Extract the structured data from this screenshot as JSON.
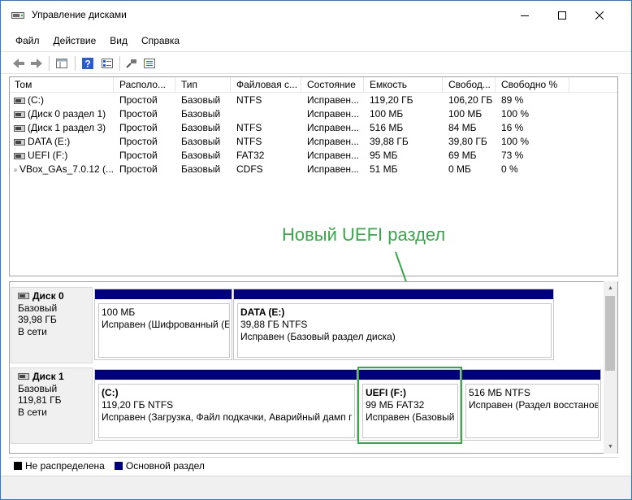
{
  "window": {
    "title": "Управление дисками"
  },
  "menu": [
    "Файл",
    "Действие",
    "Вид",
    "Справка"
  ],
  "columns": [
    "Том",
    "Располо...",
    "Тип",
    "Файловая с...",
    "Состояние",
    "Емкость",
    "Свобод...",
    "Свободно %"
  ],
  "volumes": [
    {
      "name": "(C:)",
      "layout": "Простой",
      "type": "Базовый",
      "fs": "NTFS",
      "status": "Исправен...",
      "capacity": "119,20 ГБ",
      "free": "106,20 ГБ",
      "free_pct": "89 %",
      "icon": "disk-volume-icon"
    },
    {
      "name": "(Диск 0 раздел 1)",
      "layout": "Простой",
      "type": "Базовый",
      "fs": "",
      "status": "Исправен...",
      "capacity": "100 МБ",
      "free": "100 МБ",
      "free_pct": "100 %",
      "icon": "disk-volume-icon"
    },
    {
      "name": "(Диск 1 раздел 3)",
      "layout": "Простой",
      "type": "Базовый",
      "fs": "NTFS",
      "status": "Исправен...",
      "capacity": "516 МБ",
      "free": "84 МБ",
      "free_pct": "16 %",
      "icon": "disk-volume-icon"
    },
    {
      "name": "DATA (E:)",
      "layout": "Простой",
      "type": "Базовый",
      "fs": "NTFS",
      "status": "Исправен...",
      "capacity": "39,88 ГБ",
      "free": "39,80 ГБ",
      "free_pct": "100 %",
      "icon": "disk-volume-icon"
    },
    {
      "name": "UEFI (F:)",
      "layout": "Простой",
      "type": "Базовый",
      "fs": "FAT32",
      "status": "Исправен...",
      "capacity": "95 МБ",
      "free": "69 МБ",
      "free_pct": "73 %",
      "icon": "disk-volume-icon"
    },
    {
      "name": "VBox_GAs_7.0.12 (...",
      "layout": "Простой",
      "type": "Базовый",
      "fs": "CDFS",
      "status": "Исправен...",
      "capacity": "51 МБ",
      "free": "0 МБ",
      "free_pct": "0 %",
      "icon": "cd-drive-icon"
    }
  ],
  "annotation": "Новый UEFI раздел",
  "disks": [
    {
      "name": "Диск 0",
      "kind": "Базовый",
      "size": "39,98 ГБ",
      "state": "В сети",
      "partitions": [
        {
          "title": "",
          "line1": "100 МБ",
          "line2": "Исправен (Шифрованный (E"
        },
        {
          "title": "DATA  (E:)",
          "line1": "39,88 ГБ NTFS",
          "line2": "Исправен (Базовый раздел диска)"
        }
      ]
    },
    {
      "name": "Диск 1",
      "kind": "Базовый",
      "size": "119,81 ГБ",
      "state": "В сети",
      "partitions": [
        {
          "title": "(C:)",
          "line1": "119,20 ГБ NTFS",
          "line2": "Исправен (Загрузка, Файл подкачки, Аварийный дамп г"
        },
        {
          "title": "UEFI  (F:)",
          "line1": "99 МБ FAT32",
          "line2": "Исправен (Базовый"
        },
        {
          "title": "",
          "line1": "516 МБ NTFS",
          "line2": "Исправен (Раздел восстанов."
        }
      ]
    }
  ],
  "legend": [
    {
      "label": "Не распределена",
      "color": "#000000"
    },
    {
      "label": "Основной раздел",
      "color": "#00007f"
    }
  ],
  "colors": {
    "primary_partition": "#00007f",
    "unallocated": "#000000",
    "highlight": "#3aa64b"
  }
}
